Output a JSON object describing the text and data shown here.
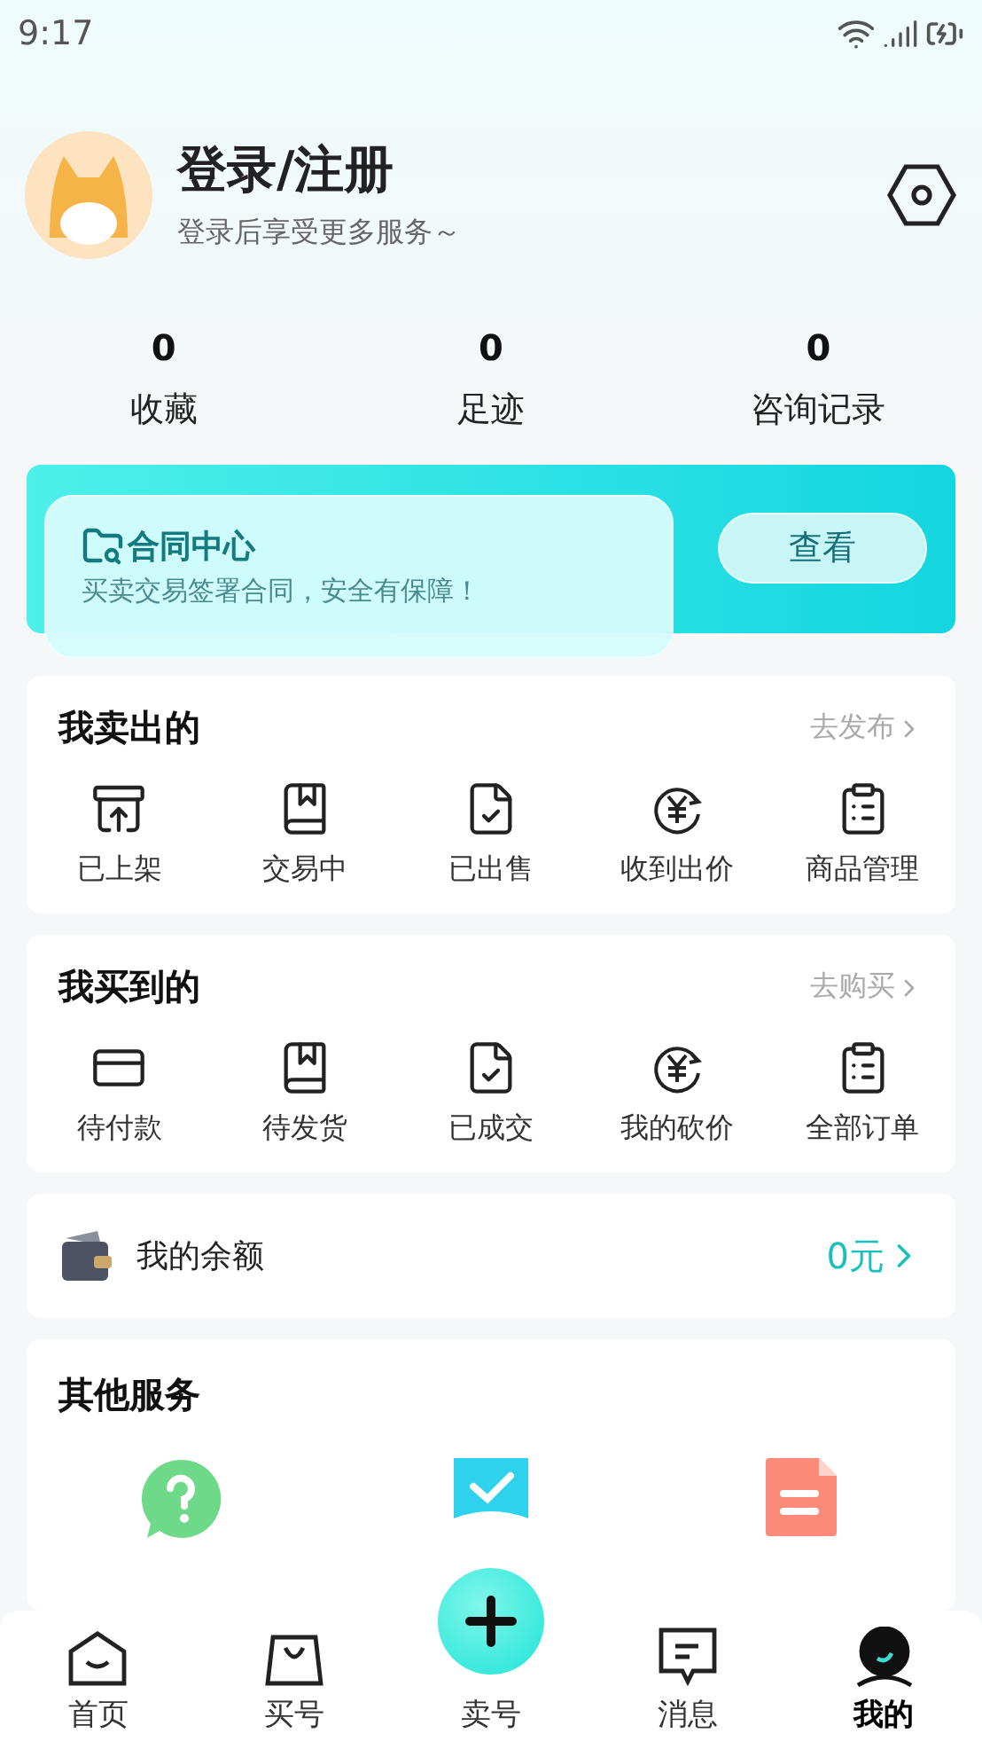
{
  "status_bar": {
    "time": "9:17"
  },
  "profile": {
    "title": "登录/注册",
    "subtitle": "登录后享受更多服务～"
  },
  "stats": [
    {
      "value": "0",
      "label": "收藏"
    },
    {
      "value": "0",
      "label": "足迹"
    },
    {
      "value": "0",
      "label": "咨询记录"
    }
  ],
  "contract_banner": {
    "title": "合同中心",
    "subtitle": "买卖交易签署合同，安全有保障！",
    "button": "查看"
  },
  "sections": [
    {
      "title": "我卖出的",
      "link": "去发布",
      "items": [
        {
          "label": "已上架",
          "kind": "shelf"
        },
        {
          "label": "交易中",
          "kind": "book"
        },
        {
          "label": "已出售",
          "kind": "check"
        },
        {
          "label": "收到出价",
          "kind": "yen"
        },
        {
          "label": "商品管理",
          "kind": "clipboard"
        }
      ]
    },
    {
      "title": "我买到的",
      "link": "去购买",
      "items": [
        {
          "label": "待付款",
          "kind": "card"
        },
        {
          "label": "待发货",
          "kind": "book"
        },
        {
          "label": "已成交",
          "kind": "check"
        },
        {
          "label": "我的砍价",
          "kind": "yen"
        },
        {
          "label": "全部订单",
          "kind": "clipboard"
        }
      ]
    }
  ],
  "balance": {
    "label": "我的余额",
    "value": "0元"
  },
  "other_services": {
    "title": "其他服务",
    "items": [
      {
        "kind": "help"
      },
      {
        "kind": "task"
      },
      {
        "kind": "doc"
      }
    ]
  },
  "bottom_nav": [
    {
      "label": "首页",
      "kind": "home",
      "selected": false
    },
    {
      "label": "买号",
      "kind": "bag",
      "selected": false
    },
    {
      "label": "卖号",
      "kind": "publish",
      "selected": false
    },
    {
      "label": "消息",
      "kind": "message",
      "selected": false
    },
    {
      "label": "我的",
      "kind": "me",
      "selected": true
    }
  ]
}
